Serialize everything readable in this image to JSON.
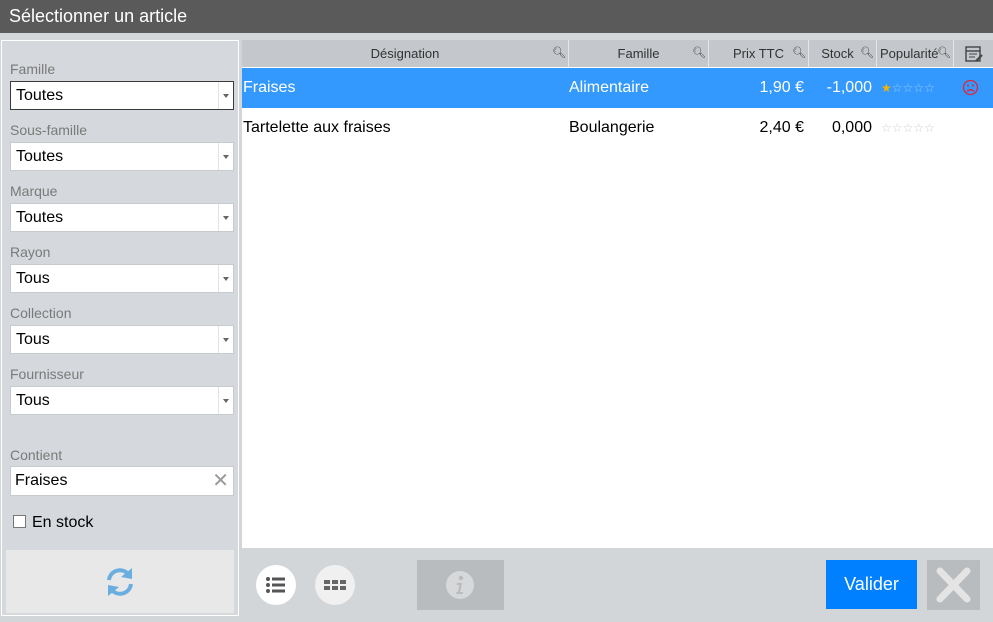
{
  "window": {
    "title": "Sélectionner un article"
  },
  "filters": {
    "famille": {
      "label": "Famille",
      "value": "Toutes"
    },
    "sous_famille": {
      "label": "Sous-famille",
      "value": "Toutes"
    },
    "marque": {
      "label": "Marque",
      "value": "Toutes"
    },
    "rayon": {
      "label": "Rayon",
      "value": "Tous"
    },
    "collection": {
      "label": "Collection",
      "value": "Tous"
    },
    "fournisseur": {
      "label": "Fournisseur",
      "value": "Tous"
    },
    "contient": {
      "label": "Contient",
      "value": "Fraises"
    },
    "en_stock": {
      "label": "En stock",
      "checked": false
    }
  },
  "table": {
    "columns": {
      "designation": "Désignation",
      "famille": "Famille",
      "prix": "Prix TTC",
      "stock": "Stock",
      "popularite": "Popularité"
    },
    "rows": [
      {
        "designation": "Fraises",
        "famille": "Alimentaire",
        "prix": "1,90 €",
        "stock": "-1,000",
        "popularite": 1,
        "selected": true,
        "status_icon": "sad-face-icon"
      },
      {
        "designation": "Tartelette aux fraises",
        "famille": "Boulangerie",
        "prix": "2,40 €",
        "stock": "0,000",
        "popularite": 0,
        "selected": false
      }
    ]
  },
  "footer": {
    "valider_label": "Valider"
  },
  "colors": {
    "title_bg": "#5a5a5a",
    "selected_row": "#3399ff",
    "valider_bg": "#0080ff",
    "star_on": "#f4b400",
    "sad_icon": "#e0243a"
  }
}
